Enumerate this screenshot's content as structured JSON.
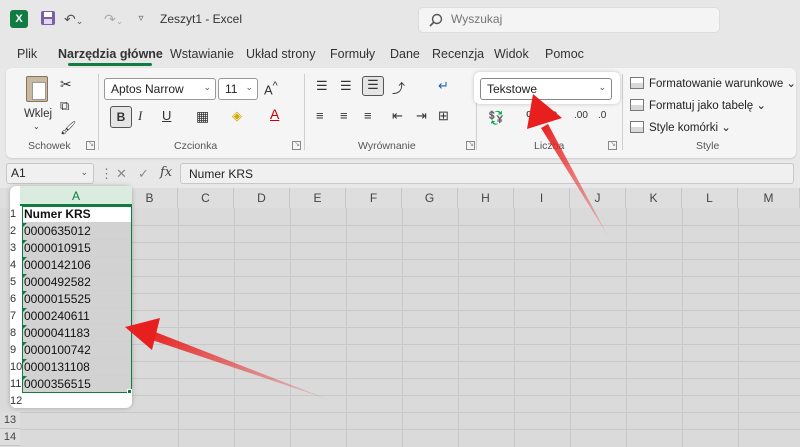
{
  "titlebar": {
    "app_letter": "X",
    "doc_title": "Zeszyt1  -  Excel",
    "search_placeholder": "Wyszukaj"
  },
  "tabs": [
    {
      "label": "Plik"
    },
    {
      "label": "Narzędzia główne"
    },
    {
      "label": "Wstawianie"
    },
    {
      "label": "Układ strony"
    },
    {
      "label": "Formuły"
    },
    {
      "label": "Dane"
    },
    {
      "label": "Recenzja"
    },
    {
      "label": "Widok"
    },
    {
      "label": "Pomoc"
    }
  ],
  "active_tab_index": 1,
  "ribbon": {
    "clipboard": {
      "paste_label": "Wklej",
      "group_label": "Schowek"
    },
    "font": {
      "font_name": "Aptos Narrow",
      "font_size": "11",
      "bold": "B",
      "italic": "I",
      "underline": "U",
      "group_label": "Czcionka"
    },
    "alignment": {
      "group_label": "Wyrównanie"
    },
    "number": {
      "format_value": "Tekstowe",
      "percent": "%",
      "group_label": "Liczba"
    },
    "styles": {
      "conditional": "Formatowanie warunkowe",
      "as_table": "Formatuj jako tabelę",
      "cell_styles": "Style komórki",
      "group_label": "Style"
    }
  },
  "formula_bar": {
    "name_box": "A1",
    "fx": "fx",
    "content": "Numer KRS"
  },
  "sheet": {
    "columns": [
      "A",
      "B",
      "C",
      "D",
      "E",
      "F",
      "G",
      "H",
      "I",
      "J",
      "K",
      "L",
      "M"
    ],
    "rows": [
      "1",
      "2",
      "3",
      "4",
      "5",
      "6",
      "7",
      "8",
      "9",
      "10",
      "11",
      "12",
      "13",
      "14"
    ],
    "column_a": [
      "Numer KRS",
      "0000635012",
      "0000010915",
      "0000142106",
      "0000492582",
      "0000015525",
      "0000240611",
      "0000041183",
      "0000100742",
      "0000131108",
      "0000356515"
    ]
  },
  "colors": {
    "accent": "#107c41",
    "arrow": "#e81f1f"
  }
}
